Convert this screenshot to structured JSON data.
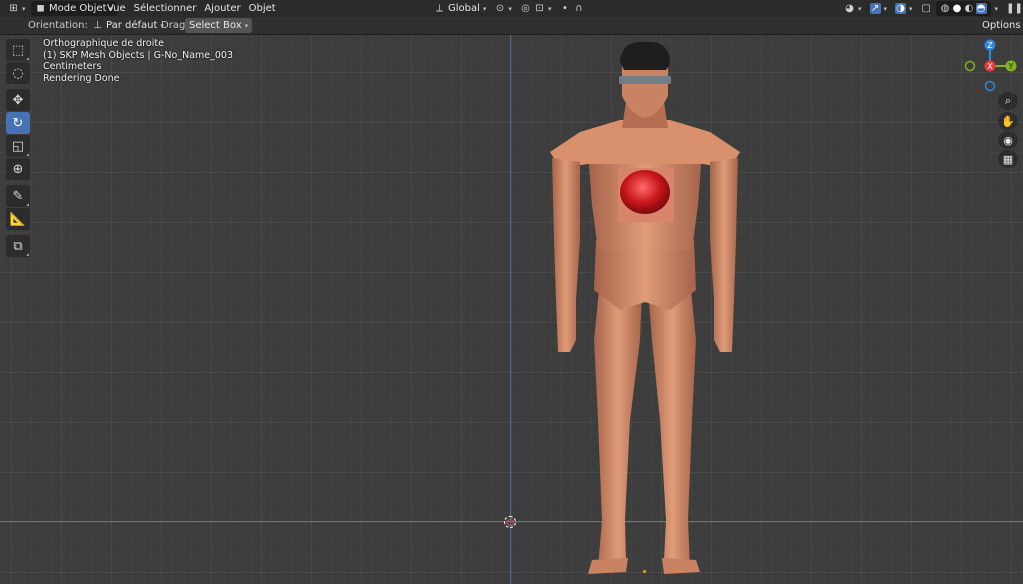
{
  "header": {
    "editor_type_icon": "3d-viewport-icon",
    "mode": "Mode Objet",
    "menus": [
      "Vue",
      "Sélectionner",
      "Ajouter",
      "Objet"
    ],
    "transform_orientation": "Global",
    "pivot_icon": "pivot-icon",
    "snap_icon": "magnet-icon",
    "proportional_icon": "proportional-edit-icon",
    "shading_modes": [
      "wireframe",
      "solid",
      "material",
      "rendered"
    ]
  },
  "tool_settings": {
    "orientation_label": "Orientation:",
    "orientation_value": "Par défaut",
    "drag_label": "Drag:",
    "drag_value": "Select Box",
    "options_label": "Options"
  },
  "viewport": {
    "view_name": "Orthographique de droite",
    "collection_info": "(1) SKP Mesh Objects | G-No_Name_003",
    "units": "Centimeters",
    "status": "Rendering Done"
  },
  "gizmo": {
    "z_label": "Z",
    "x_label": "X",
    "y_label": "Y",
    "colors": {
      "x": "#e8393f",
      "y": "#80b320",
      "z": "#2f86de"
    }
  },
  "toolbar": [
    "select-box",
    "cursor",
    "move",
    "rotate",
    "scale",
    "transform",
    "annotate",
    "measure",
    "add-cube"
  ],
  "colors": {
    "accent": "#4772b3",
    "axis_y": "#3e6c99",
    "axis_x": "#67891f"
  }
}
